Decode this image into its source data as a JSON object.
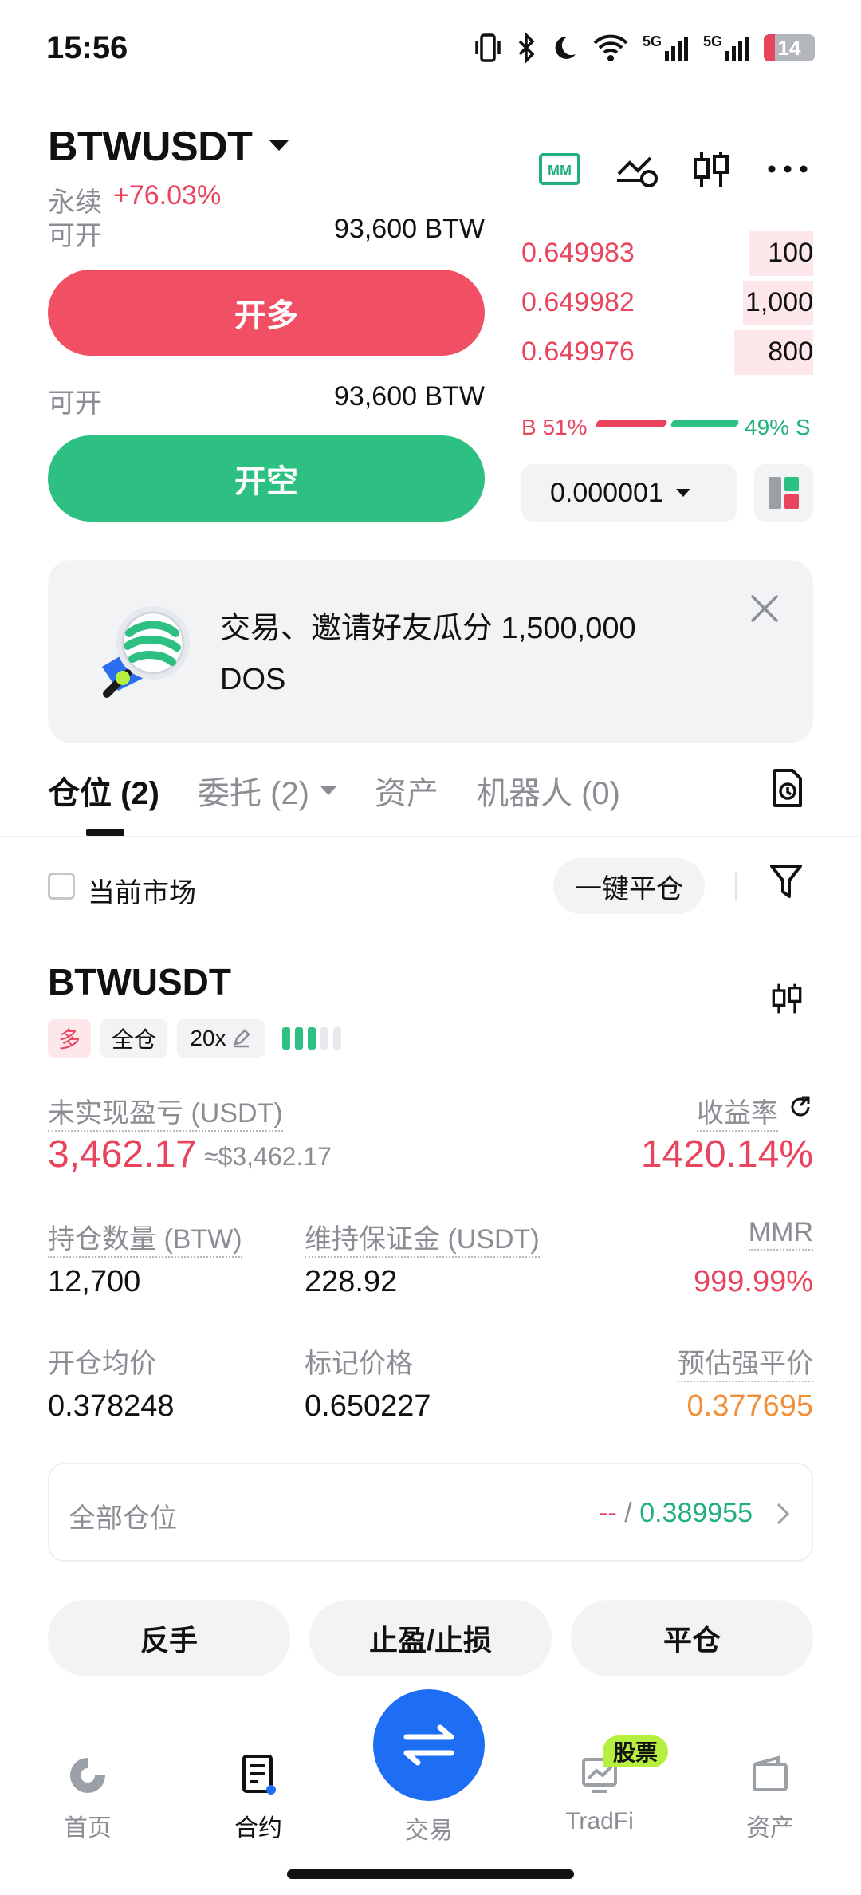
{
  "status_bar": {
    "time": "15:56",
    "battery": "14",
    "net1": "5G",
    "net2": "5G"
  },
  "header": {
    "pair": "BTWUSDT",
    "market_type": "永续",
    "change": "+76.03%"
  },
  "trade": {
    "avail_label": "可开",
    "avail_long": "93,600 BTW",
    "long_label": "开多",
    "avail_short": "93,600 BTW",
    "short_label": "开空"
  },
  "orderbook": {
    "asks": [
      {
        "price": "0.649983",
        "qty": "100",
        "depth": 0.22
      },
      {
        "price": "0.649982",
        "qty": "1,000",
        "depth": 0.24
      },
      {
        "price": "0.649976",
        "qty": "800",
        "depth": 0.27
      }
    ],
    "buy_ratio": "B 51%",
    "sell_ratio": "49% S",
    "tick_size": "0.000001"
  },
  "banner": {
    "text": "交易、邀请好友瓜分 1,500,000 DOS"
  },
  "tabs": [
    {
      "label": "仓位 (2)"
    },
    {
      "label": "委托 (2)"
    },
    {
      "label": "资产"
    },
    {
      "label": "机器人 (0)"
    }
  ],
  "filter": {
    "current_market": "当前市场",
    "close_all": "一键平仓"
  },
  "position": {
    "pair": "BTWUSDT",
    "side": "多",
    "margin_mode": "全仓",
    "leverage": "20x",
    "adl_level": 3,
    "unrealized_label": "未实现盈亏 (USDT)",
    "unrealized_value": "3,462.17",
    "unrealized_usd": "≈$3,462.17",
    "roe_label": "收益率",
    "roe_value": "1420.14%",
    "size_label": "持仓数量 (BTW)",
    "size_value": "12,700",
    "maint_label": "维持保证金 (USDT)",
    "maint_value": "228.92",
    "mmr_label": "MMR",
    "mmr_value": "999.99%",
    "entry_label": "开仓均价",
    "entry_value": "0.378248",
    "mark_label": "标记价格",
    "mark_value": "0.650227",
    "liq_label": "预估强平价",
    "liq_value": "0.377695",
    "all_positions_label": "全部仓位",
    "all_positions_left": "--",
    "all_positions_sep": " / ",
    "all_positions_right": "0.389955",
    "reverse_label": "反手",
    "tpsl_label": "止盈/止损",
    "close_label": "平仓"
  },
  "nav": [
    {
      "label": "首页"
    },
    {
      "label": "合约"
    },
    {
      "label": "交易"
    },
    {
      "label": "TradFi"
    },
    {
      "label": "资产"
    }
  ],
  "nav_badge": "股票",
  "colors": {
    "red": "#e8445e",
    "green": "#21b07a",
    "blue": "#1e6ef5",
    "orange": "#f0913a"
  }
}
